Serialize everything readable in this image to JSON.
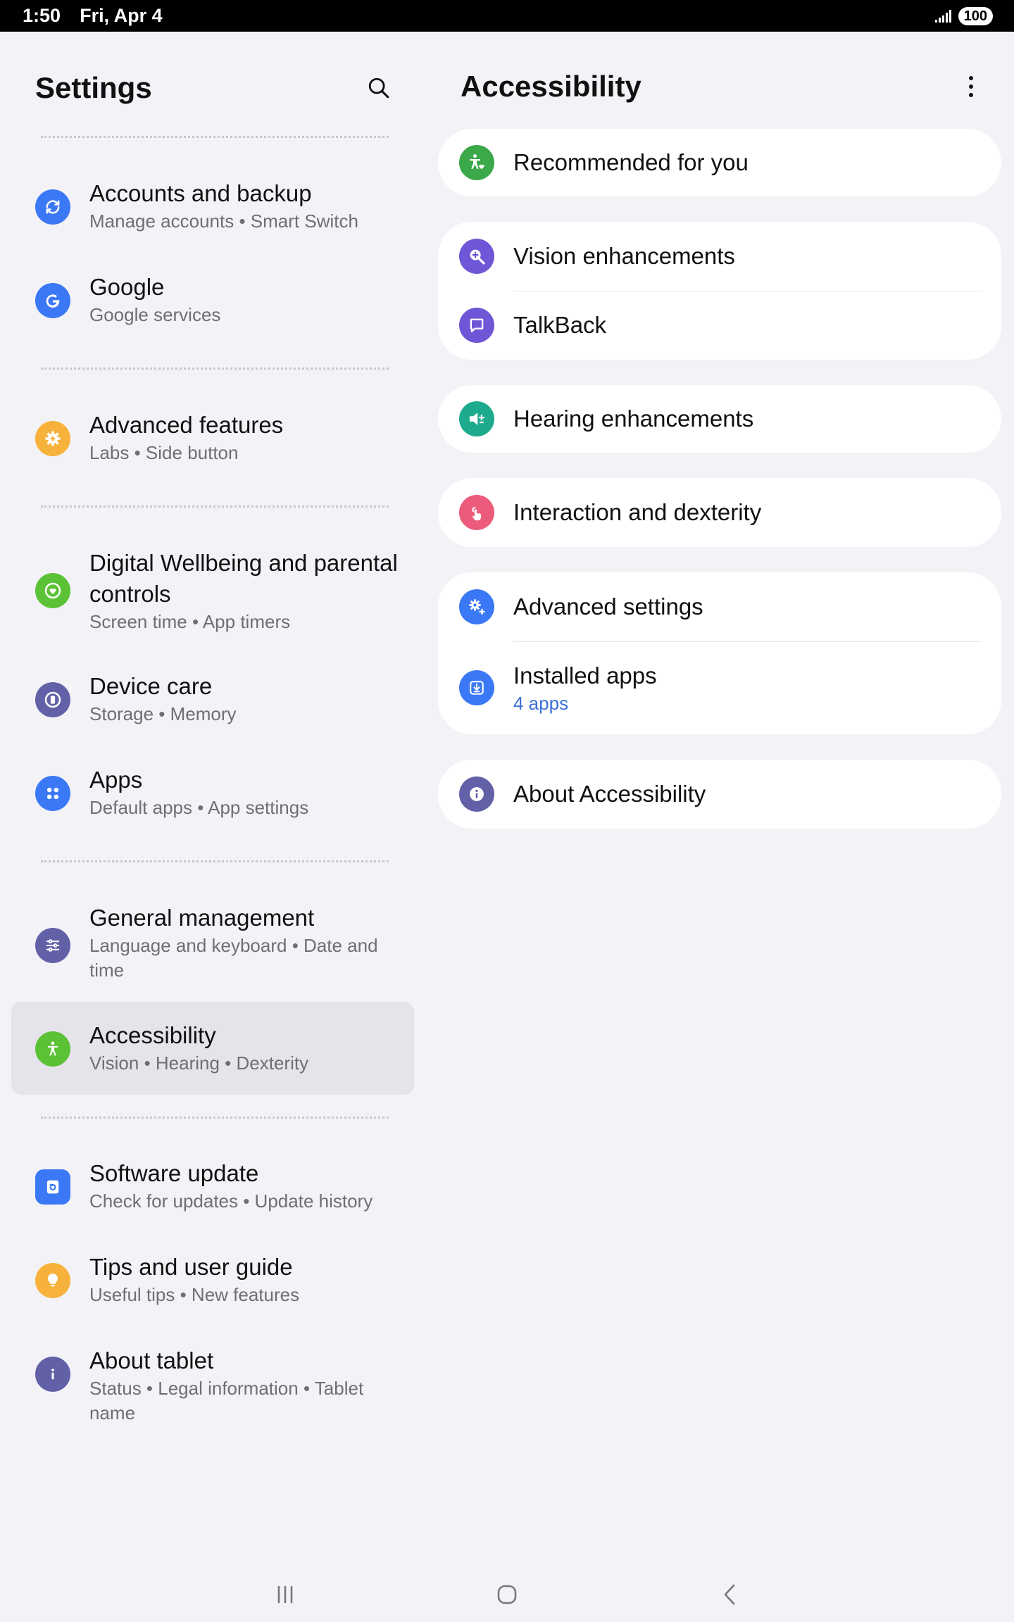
{
  "status_bar": {
    "time": "1:50",
    "date": "Fri, Apr 4",
    "battery": "100"
  },
  "settings": {
    "title": "Settings",
    "items": [
      {
        "title": "Accounts and backup",
        "subtitle": "Manage accounts  •  Smart Switch",
        "icon": "sync-icon",
        "color": "#3b78f5"
      },
      {
        "title": "Google",
        "subtitle": "Google services",
        "icon": "google-icon",
        "color": "#3b78f5"
      },
      {
        "title": "Advanced features",
        "subtitle": "Labs  •  Side button",
        "icon": "gear-plus-icon",
        "color": "#f7b23b"
      },
      {
        "title": "Digital Wellbeing and parental controls",
        "subtitle": "Screen time  •  App timers",
        "icon": "heart-circle-icon",
        "color": "#5bc236"
      },
      {
        "title": "Device care",
        "subtitle": "Storage  •  Memory",
        "icon": "device-care-icon",
        "color": "#6261a8"
      },
      {
        "title": "Apps",
        "subtitle": "Default apps  •  App settings",
        "icon": "apps-grid-icon",
        "color": "#3b78f5"
      },
      {
        "title": "General management",
        "subtitle": "Language and keyboard  •  Date and time",
        "icon": "sliders-icon",
        "color": "#6261a8"
      },
      {
        "title": "Accessibility",
        "subtitle": "Vision  •  Hearing  •  Dexterity",
        "icon": "accessibility-icon",
        "color": "#5bc236"
      },
      {
        "title": "Software update",
        "subtitle": "Check for updates  •  Update history",
        "icon": "software-update-icon",
        "color": "#3b78f5"
      },
      {
        "title": "Tips and user guide",
        "subtitle": "Useful tips  •  New features",
        "icon": "lightbulb-icon",
        "color": "#f7b23b"
      },
      {
        "title": "About tablet",
        "subtitle": "Status  •  Legal information  •  Tablet name",
        "icon": "info-icon",
        "color": "#6261a8"
      }
    ]
  },
  "accessibility": {
    "title": "Accessibility",
    "cards": [
      [
        {
          "title": "Recommended for you",
          "icon": "person-heart-icon",
          "color": "#3ba84a"
        }
      ],
      [
        {
          "title": "Vision enhancements",
          "icon": "magnifier-plus-icon",
          "color": "#6e56d6"
        },
        {
          "title": "TalkBack",
          "icon": "talkback-icon",
          "color": "#6e56d6"
        }
      ],
      [
        {
          "title": "Hearing enhancements",
          "icon": "speaker-plus-icon",
          "color": "#1eaa8c"
        }
      ],
      [
        {
          "title": "Interaction and dexterity",
          "icon": "touch-hand-icon",
          "color": "#ec5b7b"
        }
      ],
      [
        {
          "title": "Advanced settings",
          "icon": "gear-plus-icon",
          "color": "#3b78f5"
        },
        {
          "title": "Installed apps",
          "subtitle": "4 apps",
          "icon": "download-box-icon",
          "color": "#3b78f5"
        }
      ],
      [
        {
          "title": "About Accessibility",
          "icon": "info-icon",
          "color": "#6261a8"
        }
      ]
    ]
  }
}
